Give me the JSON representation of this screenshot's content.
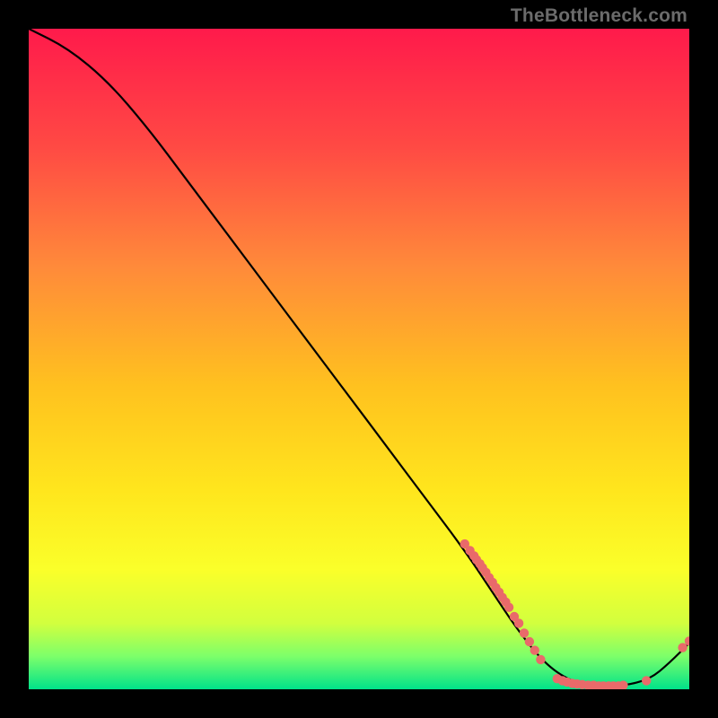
{
  "attribution": "TheBottleneck.com",
  "colors": {
    "gradient_top": "#ff1a4b",
    "gradient_upper_mid": "#ff7a3a",
    "gradient_mid": "#ffd21f",
    "gradient_lower_mid": "#f6ff2d",
    "gradient_green_band_top": "#b8ff55",
    "gradient_green_band_bottom": "#00e28a",
    "line": "#000000",
    "dot": "#e96a6a",
    "background": "#000000"
  },
  "chart_data": {
    "type": "line",
    "title": "",
    "xlabel": "",
    "ylabel": "",
    "xlim": [
      0,
      100
    ],
    "ylim": [
      0,
      100
    ],
    "curve": [
      {
        "x": 0,
        "y": 100
      },
      {
        "x": 6,
        "y": 97
      },
      {
        "x": 12,
        "y": 92
      },
      {
        "x": 18,
        "y": 85
      },
      {
        "x": 24,
        "y": 77
      },
      {
        "x": 30,
        "y": 69
      },
      {
        "x": 36,
        "y": 61
      },
      {
        "x": 42,
        "y": 53
      },
      {
        "x": 48,
        "y": 45
      },
      {
        "x": 54,
        "y": 37
      },
      {
        "x": 60,
        "y": 29
      },
      {
        "x": 66,
        "y": 21
      },
      {
        "x": 70,
        "y": 15
      },
      {
        "x": 74,
        "y": 9
      },
      {
        "x": 78,
        "y": 4
      },
      {
        "x": 82,
        "y": 1.2
      },
      {
        "x": 86,
        "y": 0.5
      },
      {
        "x": 90,
        "y": 0.5
      },
      {
        "x": 94,
        "y": 1.5
      },
      {
        "x": 97,
        "y": 4.0
      },
      {
        "x": 100,
        "y": 7.0
      }
    ],
    "scatter_clusters": [
      {
        "x": 66.0,
        "y": 22.0
      },
      {
        "x": 66.8,
        "y": 21.0
      },
      {
        "x": 67.4,
        "y": 20.2
      },
      {
        "x": 67.8,
        "y": 19.6
      },
      {
        "x": 68.3,
        "y": 19.0
      },
      {
        "x": 68.7,
        "y": 18.4
      },
      {
        "x": 69.2,
        "y": 17.7
      },
      {
        "x": 69.7,
        "y": 16.9
      },
      {
        "x": 70.2,
        "y": 16.2
      },
      {
        "x": 70.7,
        "y": 15.4
      },
      {
        "x": 71.2,
        "y": 14.7
      },
      {
        "x": 71.7,
        "y": 13.9
      },
      {
        "x": 72.2,
        "y": 13.2
      },
      {
        "x": 72.7,
        "y": 12.4
      },
      {
        "x": 73.5,
        "y": 11.0
      },
      {
        "x": 74.2,
        "y": 10.0
      },
      {
        "x": 75.0,
        "y": 8.5
      },
      {
        "x": 75.8,
        "y": 7.2
      },
      {
        "x": 76.6,
        "y": 5.9
      },
      {
        "x": 77.5,
        "y": 4.5
      },
      {
        "x": 80.0,
        "y": 1.6
      },
      {
        "x": 80.8,
        "y": 1.3
      },
      {
        "x": 81.5,
        "y": 1.1
      },
      {
        "x": 82.3,
        "y": 0.9
      },
      {
        "x": 83.0,
        "y": 0.8
      },
      {
        "x": 83.8,
        "y": 0.7
      },
      {
        "x": 84.7,
        "y": 0.6
      },
      {
        "x": 85.5,
        "y": 0.6
      },
      {
        "x": 86.3,
        "y": 0.5
      },
      {
        "x": 87.0,
        "y": 0.5
      },
      {
        "x": 87.8,
        "y": 0.5
      },
      {
        "x": 88.5,
        "y": 0.5
      },
      {
        "x": 89.3,
        "y": 0.5
      },
      {
        "x": 90.0,
        "y": 0.6
      },
      {
        "x": 93.5,
        "y": 1.3
      },
      {
        "x": 99.0,
        "y": 6.3
      },
      {
        "x": 100.0,
        "y": 7.3
      }
    ]
  }
}
